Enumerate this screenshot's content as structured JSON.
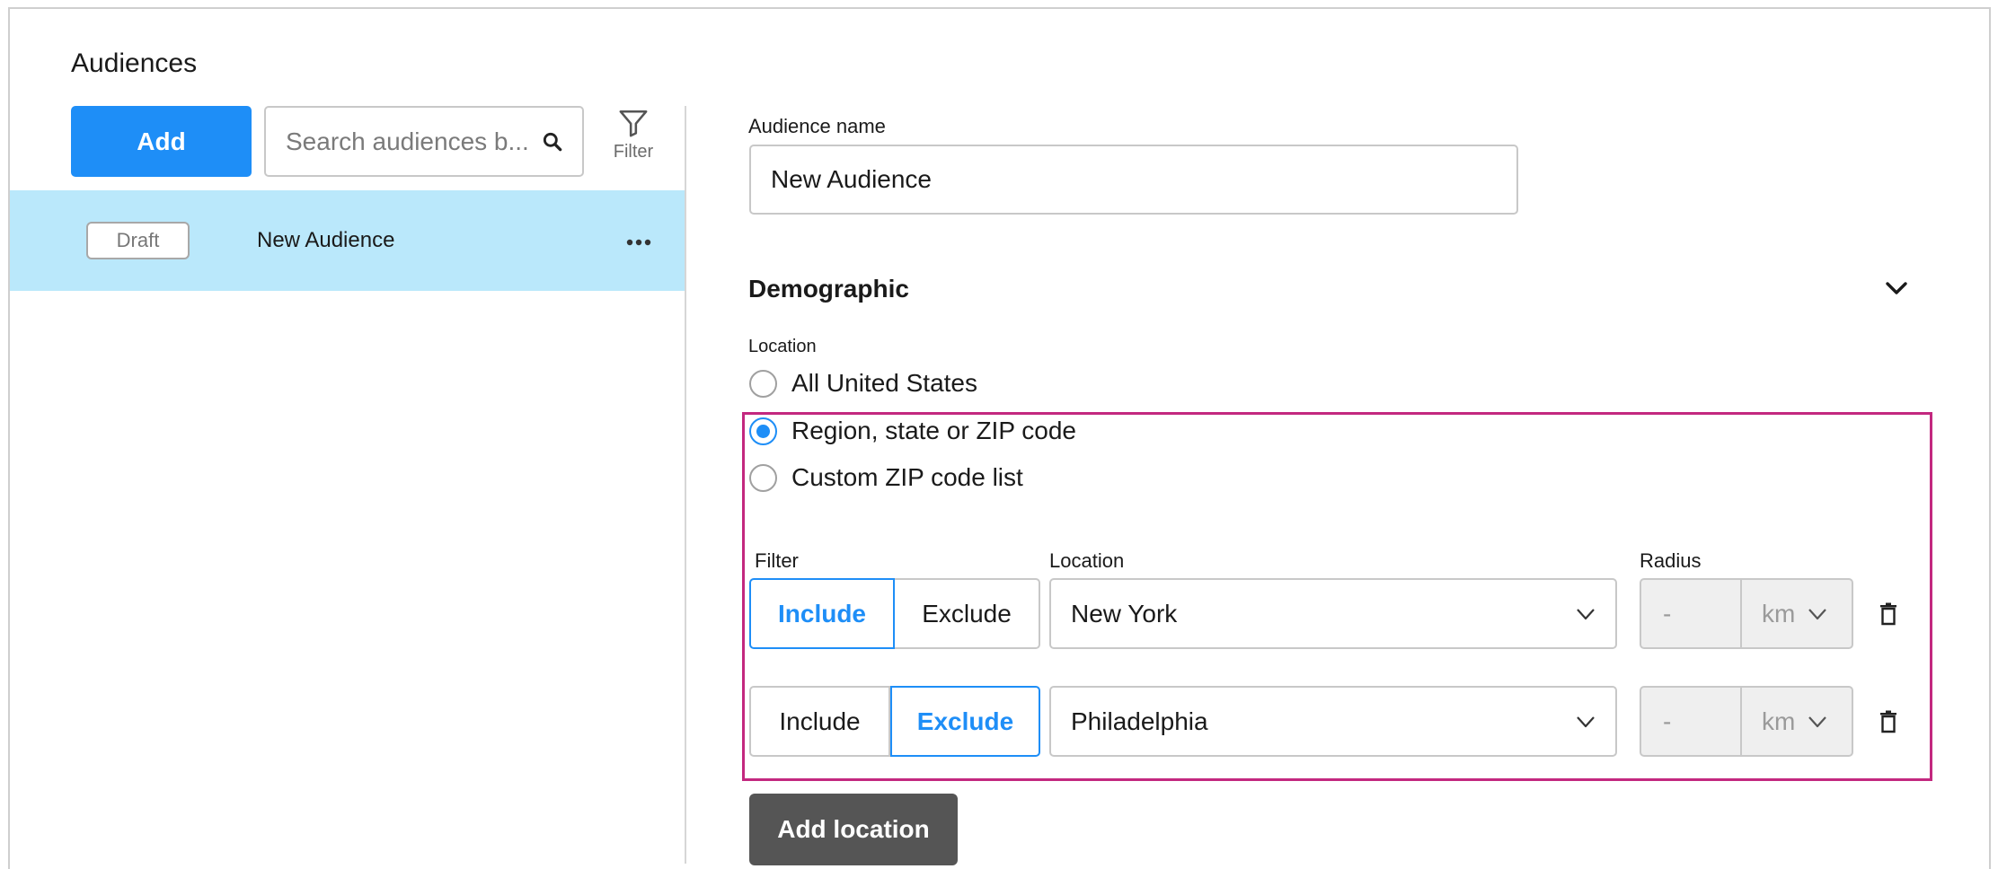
{
  "sidebar": {
    "title": "Audiences",
    "add_label": "Add",
    "search_placeholder": "Search audiences b...",
    "filter_label": "Filter",
    "items": [
      {
        "status": "Draft",
        "name": "New Audience"
      }
    ]
  },
  "form": {
    "audience_name_label": "Audience name",
    "audience_name_value": "New Audience",
    "section_title": "Demographic",
    "location_label": "Location",
    "location_options": [
      {
        "label": "All United States",
        "checked": false
      },
      {
        "label": "Region, state or ZIP code",
        "checked": true
      },
      {
        "label": "Custom ZIP code list",
        "checked": false
      }
    ],
    "col_filter": "Filter",
    "col_location": "Location",
    "col_radius": "Radius",
    "include_label": "Include",
    "exclude_label": "Exclude",
    "rows": [
      {
        "mode": "Include",
        "location": "New York",
        "radius": "-",
        "unit": "km"
      },
      {
        "mode": "Exclude",
        "location": "Philadelphia",
        "radius": "-",
        "unit": "km"
      }
    ],
    "add_location_label": "Add location"
  },
  "colors": {
    "accent": "#1e8ef7",
    "selected_row": "#bae8fb",
    "highlight_border": "#c3287f",
    "dark_button": "#555555"
  }
}
